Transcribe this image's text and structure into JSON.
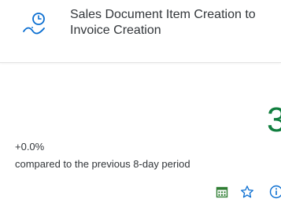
{
  "tile": {
    "title": "Sales Document Item Creation to Invoice Creation",
    "kpi_value_partial": "3",
    "delta": "+0.0%",
    "comparison": "compared to the previous 8-day period"
  },
  "icons": {
    "app": "process-flow-time-icon",
    "footer": [
      "calendar-icon",
      "favorite-star-icon",
      "info-icon"
    ]
  },
  "colors": {
    "accent": "#0a6ed1",
    "positive": "#107e3e",
    "text": "#32363a"
  }
}
